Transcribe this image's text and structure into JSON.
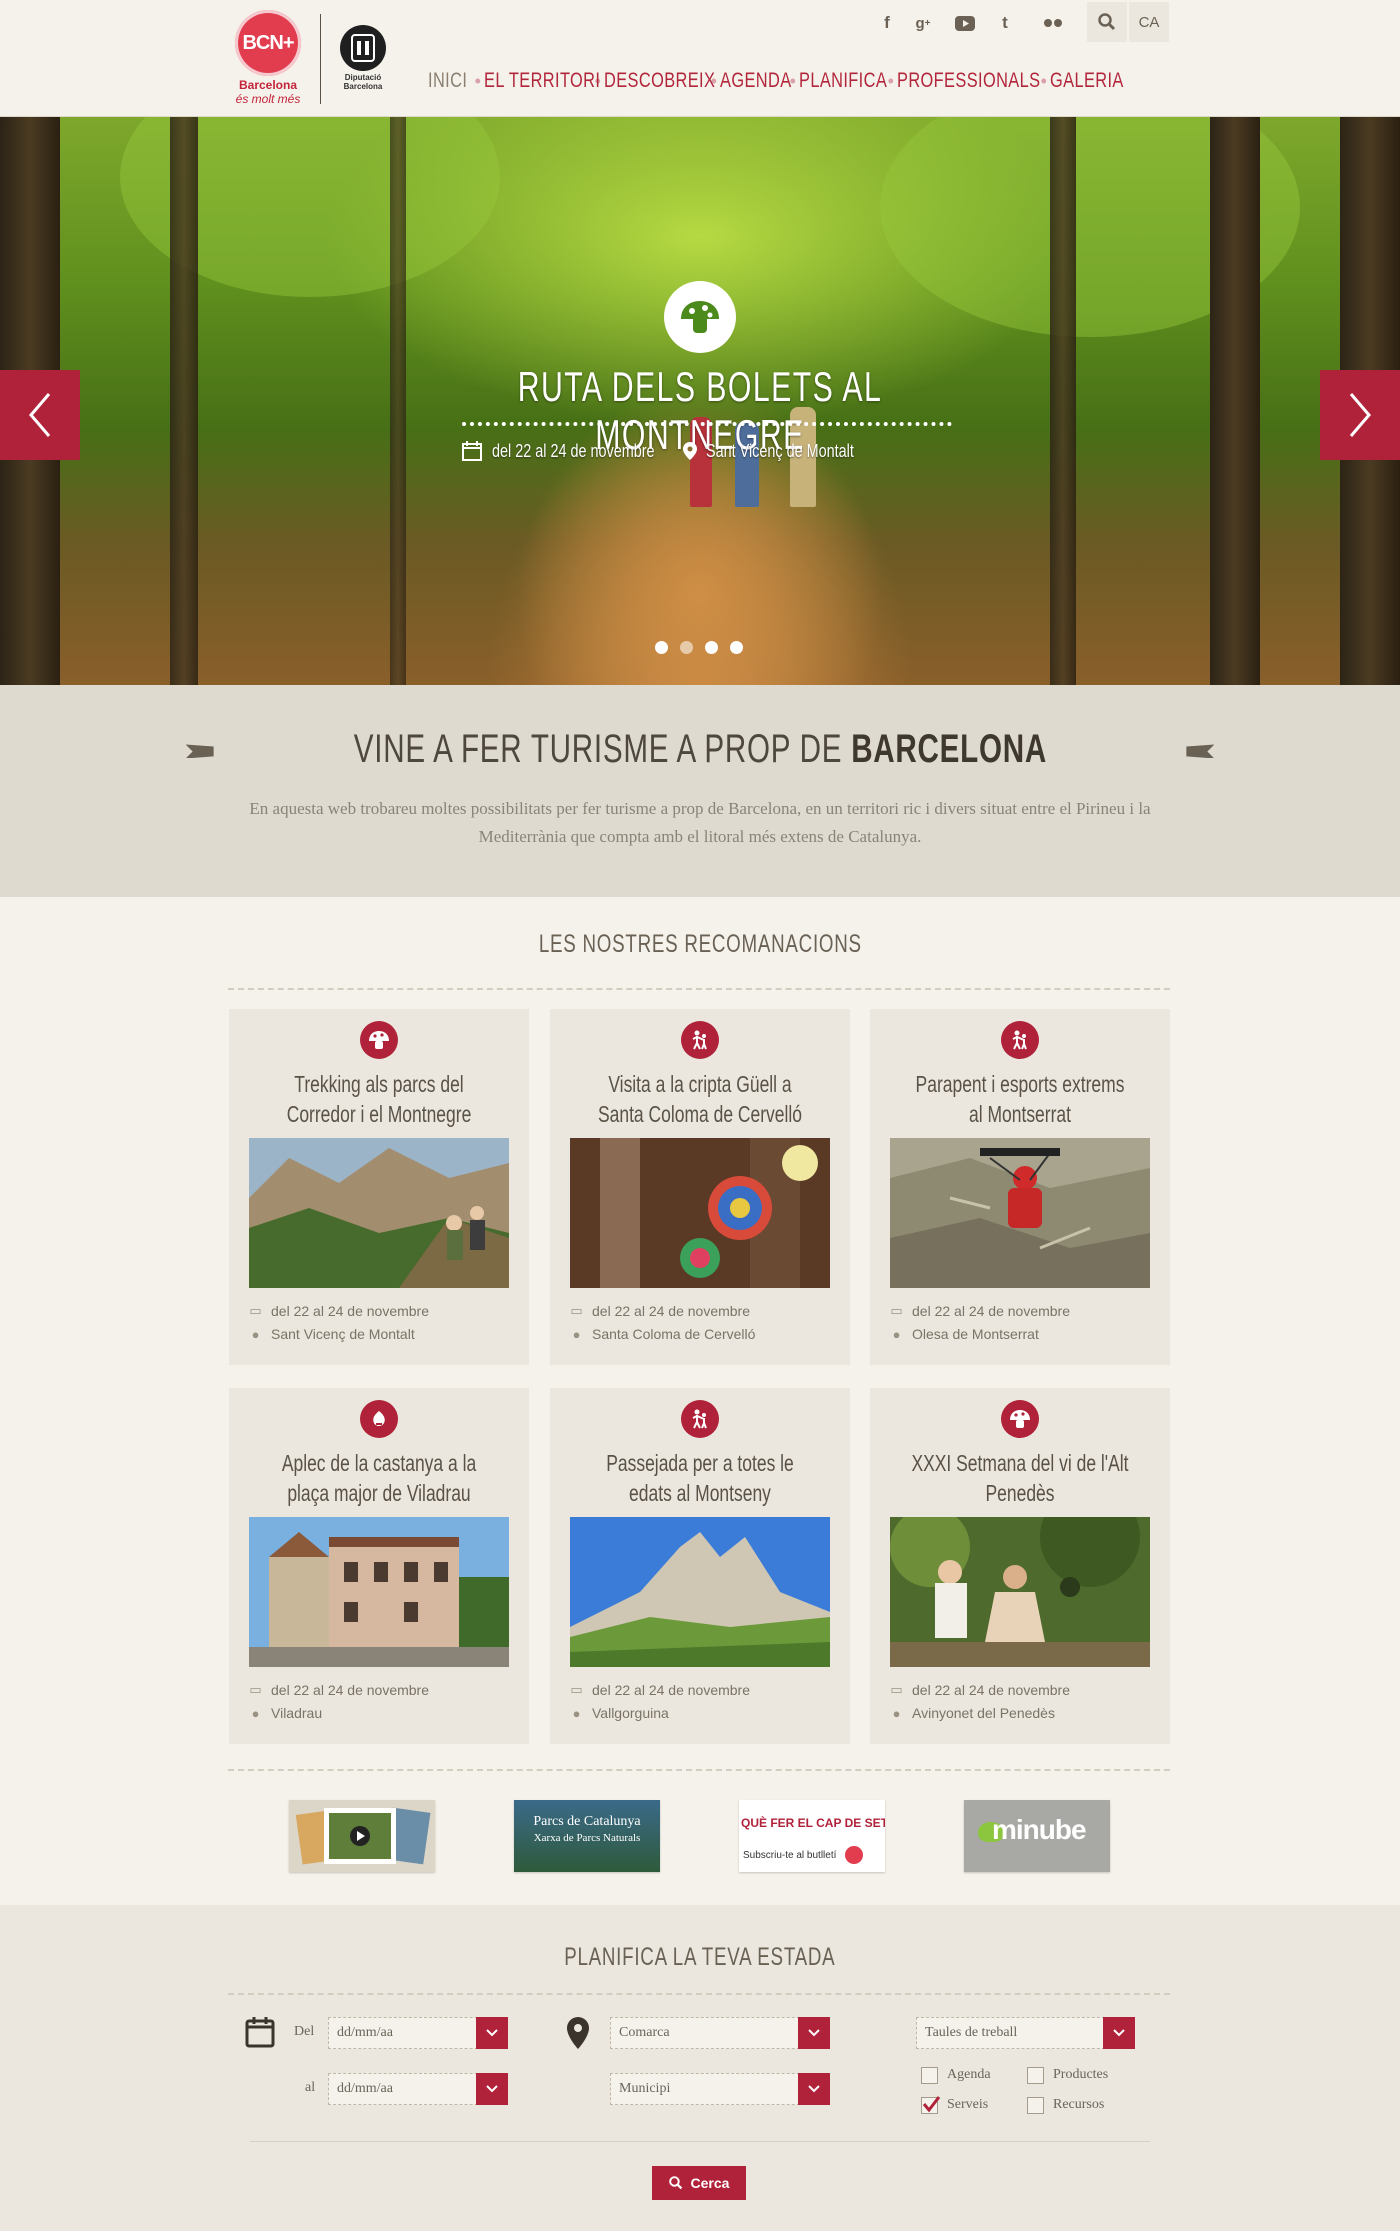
{
  "header": {
    "logo_bcn": {
      "mark": "BCN+",
      "line1": "Barcelona",
      "line2": "és molt més"
    },
    "logo_dip": {
      "line1": "Diputació",
      "line2": "Barcelona"
    },
    "social": [
      "facebook-icon",
      "google-plus-icon",
      "youtube-icon",
      "tumblr-icon",
      "flickr-icon"
    ],
    "language": "CA",
    "nav": [
      "INICI",
      "EL TERRITORI",
      "DESCOBREIX",
      "AGENDA",
      "PLANIFICA",
      "PROFESSIONALS",
      "GALERIA"
    ]
  },
  "hero": {
    "title": "RUTA DELS BOLETS AL MONTNEGRE",
    "date": "del 22 al 24 de novembre",
    "place": "Sant Vicenç de Montalt",
    "slide_count": 4,
    "active_slide": 1
  },
  "intro": {
    "title_prefix": "VINE A FER TURISME A PROP DE",
    "title_bold": "BARCELONA",
    "text": "En aquesta web trobareu moltes possibilitats per fer turisme a prop de Barcelona, en un territori ric i divers situat entre el Pirineu i la Mediterrània que compta amb el litoral més extens de Catalunya."
  },
  "recommendations": {
    "title": "LES NOSTRES RECOMANACIONS",
    "cards": [
      {
        "icon": "mushroom-icon",
        "title": "Trekking als parcs del Corredor i el Montnegre",
        "date": "del 22 al 24 de novembre",
        "place": "Sant Vicenç de Montalt"
      },
      {
        "icon": "family-icon",
        "title": "Visita a la cripta Güell a Santa Coloma de Cervelló",
        "date": "del 22 al 24 de novembre",
        "place": "Santa Coloma de Cervelló"
      },
      {
        "icon": "family-icon",
        "title": "Parapent i esports extrems al Montserrat",
        "date": "del 22 al 24 de novembre",
        "place": "Olesa de Montserrat"
      },
      {
        "icon": "chestnut-icon",
        "title": "Aplec de la castanya a la plaça major de Viladrau",
        "date": "del 22 al 24 de novembre",
        "place": "Viladrau"
      },
      {
        "icon": "family-icon",
        "title": "Passejada per a totes le edats al Montseny",
        "date": "del 22 al 24 de novembre",
        "place": "Vallgorguina"
      },
      {
        "icon": "mushroom-icon",
        "title": "XXXI Setmana del vi de l'Alt Penedès",
        "date": "del 22 al 24 de novembre",
        "place": "Avinyonet del Penedès"
      }
    ]
  },
  "partners": {
    "parcs_line1": "Parcs de Catalunya",
    "parcs_line2": "Xarxa de Parcs Naturals",
    "cap_line1": "QUÈ FER EL CAP DE SETMANA?",
    "cap_line2": "Subscriu-te al butlletí",
    "minube": "minube"
  },
  "planner": {
    "title": "PLANIFICA LA TEVA ESTADA",
    "from_label": "Del",
    "to_label": "al",
    "date_placeholder": "dd/mm/aa",
    "comarca": "Comarca",
    "municipi": "Municipi",
    "type_select": "Taules de treball",
    "checkboxes": [
      {
        "label": "Agenda",
        "checked": false
      },
      {
        "label": "Productes",
        "checked": false
      },
      {
        "label": "Serveis",
        "checked": true
      },
      {
        "label": "Recursos",
        "checked": false
      }
    ],
    "search_button": "Cerca"
  },
  "colors": {
    "accent": "#b0223a",
    "background": "#f5f2eb",
    "band": "#dedad0",
    "card": "#ebe7de"
  }
}
